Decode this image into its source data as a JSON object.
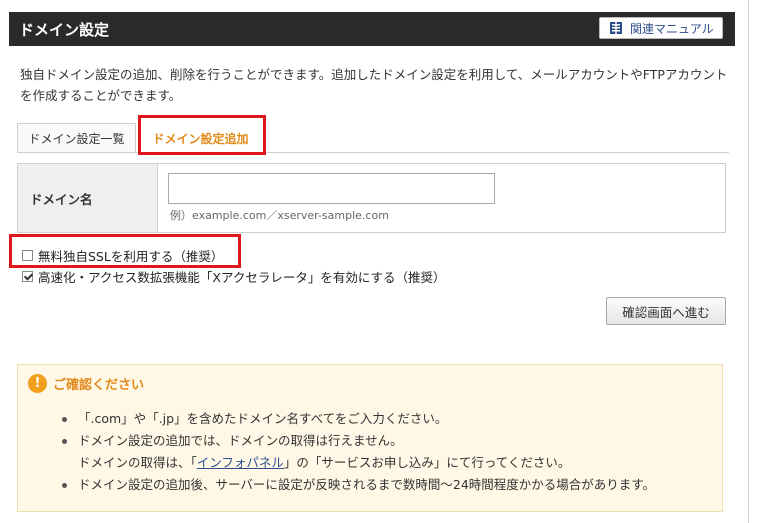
{
  "header": {
    "title": "ドメイン設定",
    "manual_button": "関連マニュアル"
  },
  "description": "独自ドメイン設定の追加、削除を行うことができます。追加したドメイン設定を利用して、メールアカウントやFTPアカウントを作成することができます。",
  "tabs": [
    {
      "label": "ドメイン設定一覧",
      "active": false
    },
    {
      "label": "ドメイン設定追加",
      "active": true
    }
  ],
  "form": {
    "domain_label": "ドメイン名",
    "domain_value": "",
    "domain_placeholder": "",
    "domain_hint": "例）example.com／xserver-sample.com"
  },
  "options": {
    "ssl_label": "無料独自SSLを利用する（推奨）",
    "ssl_checked": false,
    "accelerator_label": "高速化・アクセス数拡張機能「Xアクセラレータ」を有効にする（推奨）",
    "accelerator_checked": true
  },
  "confirm_button": "確認画面へ進む",
  "notice": {
    "title": "ご確認ください",
    "item1": "「.com」や「.jp」を含めたドメイン名すべてをご入力ください。",
    "item2_line1": "ドメイン設定の追加では、ドメインの取得は行えません。",
    "item2_line2_pre": "ドメインの取得は、「",
    "item2_link": "インフォパネル",
    "item2_line2_post": "」の「サービスお申し込み」にて行ってください。",
    "item3": "ドメイン設定の追加後、サーバーに設定が反映されるまで数時間〜24時間程度かかる場合があります。"
  },
  "colors": {
    "header_bg": "#2a2a2a",
    "accent_orange": "#e28a1c",
    "highlight_red": "#e0161d",
    "link_blue": "#2d4f8e",
    "notice_bg": "#fff8e6"
  },
  "icons": {
    "manual": "book-icon",
    "notice": "warning-icon"
  }
}
